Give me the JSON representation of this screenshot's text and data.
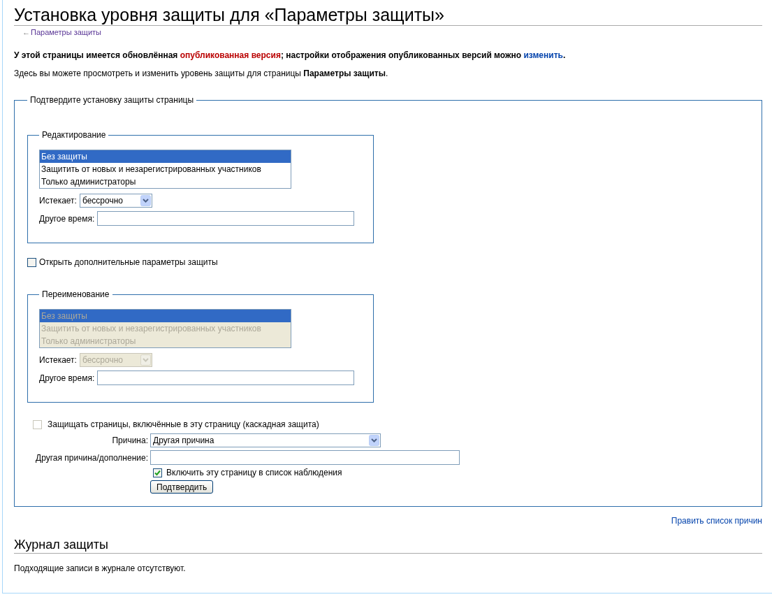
{
  "title": "Установка уровня защиты для «Параметры защиты»",
  "back_link": {
    "arrow": "←",
    "label": "Параметры защиты"
  },
  "notice": [
    {
      "kind": "text",
      "text": "У этой страницы имеется обновлённая "
    },
    {
      "kind": "flagged_link",
      "text": "опубликованная версия"
    },
    {
      "kind": "text",
      "text": "; настройки отображения опубликованных версий можно "
    },
    {
      "kind": "link",
      "text": "изменить"
    },
    {
      "kind": "text",
      "text": "."
    }
  ],
  "intro": "Здесь вы можете просмотреть и изменить уровень защиты для страницы **Параметры защиты**.",
  "form": {
    "legend": "Подтвердите установку защиты страницы",
    "sections": [
      {
        "legend": "Редактирование",
        "disabled": false,
        "options": [
          {
            "label": "Без защиты",
            "selected": true
          },
          {
            "label": "Защитить от новых и незарегистрированных участников",
            "selected": false
          },
          {
            "label": "Только администраторы",
            "selected": false
          }
        ],
        "expiry_label": "Истекает:",
        "expiry_value": "бессрочно",
        "other_time_label": "Другое время:"
      },
      {
        "legend": "Переименование",
        "disabled": true,
        "options": [
          {
            "label": "Без защиты",
            "selected": true
          },
          {
            "label": "Защитить от новых и незарегистрированных участников",
            "selected": false
          },
          {
            "label": "Только администраторы",
            "selected": false
          }
        ],
        "expiry_label": "Истекает:",
        "expiry_value": "бессрочно",
        "other_time_label": "Другое время:"
      }
    ],
    "unlock": {
      "label": "Открыть дополнительные параметры защиты",
      "checked": false
    },
    "cascade": {
      "label": "Защищать страницы, включённые в эту страницу (каскадная защита)",
      "checked": false,
      "disabled": true
    },
    "reason_label": "Причина:",
    "reason_value": "Другая причина",
    "other_reason_label": "Другая причина/дополнение:",
    "watch": {
      "label": "Включить эту страницу в список наблюдения",
      "checked": true,
      "disabled": false
    },
    "submit": "Подтвердить"
  },
  "edit_reasons_link": "Править список причин",
  "log_title": "Журнал защиты",
  "log_text": "Подходящие записи в журнале отсутствуют."
}
